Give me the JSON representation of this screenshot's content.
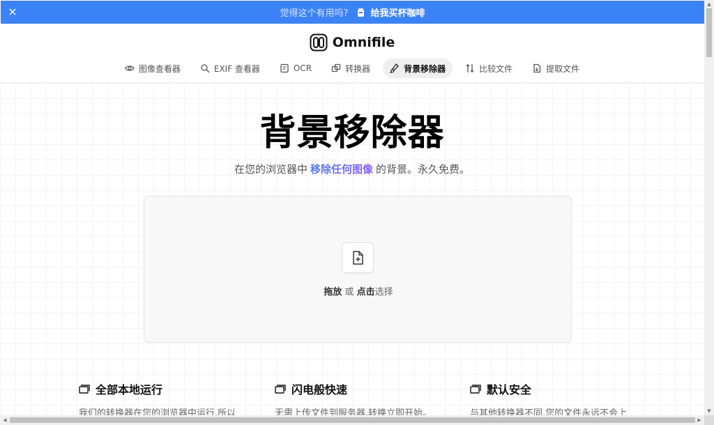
{
  "banner": {
    "close_icon": "×",
    "question": "觉得这个有用吗?",
    "cta": "给我买杯咖啡"
  },
  "brand": {
    "name": "Omnifile"
  },
  "nav": {
    "tabs": [
      {
        "label": "图像查看器",
        "icon": "eye-icon"
      },
      {
        "label": "EXIF 查看器",
        "icon": "search-icon"
      },
      {
        "label": "OCR",
        "icon": "document-text-icon"
      },
      {
        "label": "转换器",
        "icon": "convert-icon"
      },
      {
        "label": "背景移除器",
        "icon": "brush-icon",
        "active": true
      },
      {
        "label": "比较文件",
        "icon": "compare-icon"
      },
      {
        "label": "提取文件",
        "icon": "extract-file-icon"
      }
    ]
  },
  "hero": {
    "title": "背景移除器",
    "subtitle_pre": "在您的浏览器中",
    "subtitle_highlight": "移除任何图像",
    "subtitle_post": "的背景。永久免费。"
  },
  "dropzone": {
    "drag": "拖放",
    "or": " 或 ",
    "click": "点击",
    "select": "选择"
  },
  "features": [
    {
      "title": "全部本地运行",
      "desc": "我们的转换器在您的浏览器中运行,所以"
    },
    {
      "title": "闪电般快速",
      "desc": "无需上传文件到服务器,转换立即开始。"
    },
    {
      "title": "默认安全",
      "desc": "与其他转换器不同,您的文件永远不会上"
    }
  ],
  "colors": {
    "banner": "#3b82f6",
    "highlight_start": "#4f7df0",
    "highlight_end": "#8b5cf6"
  }
}
